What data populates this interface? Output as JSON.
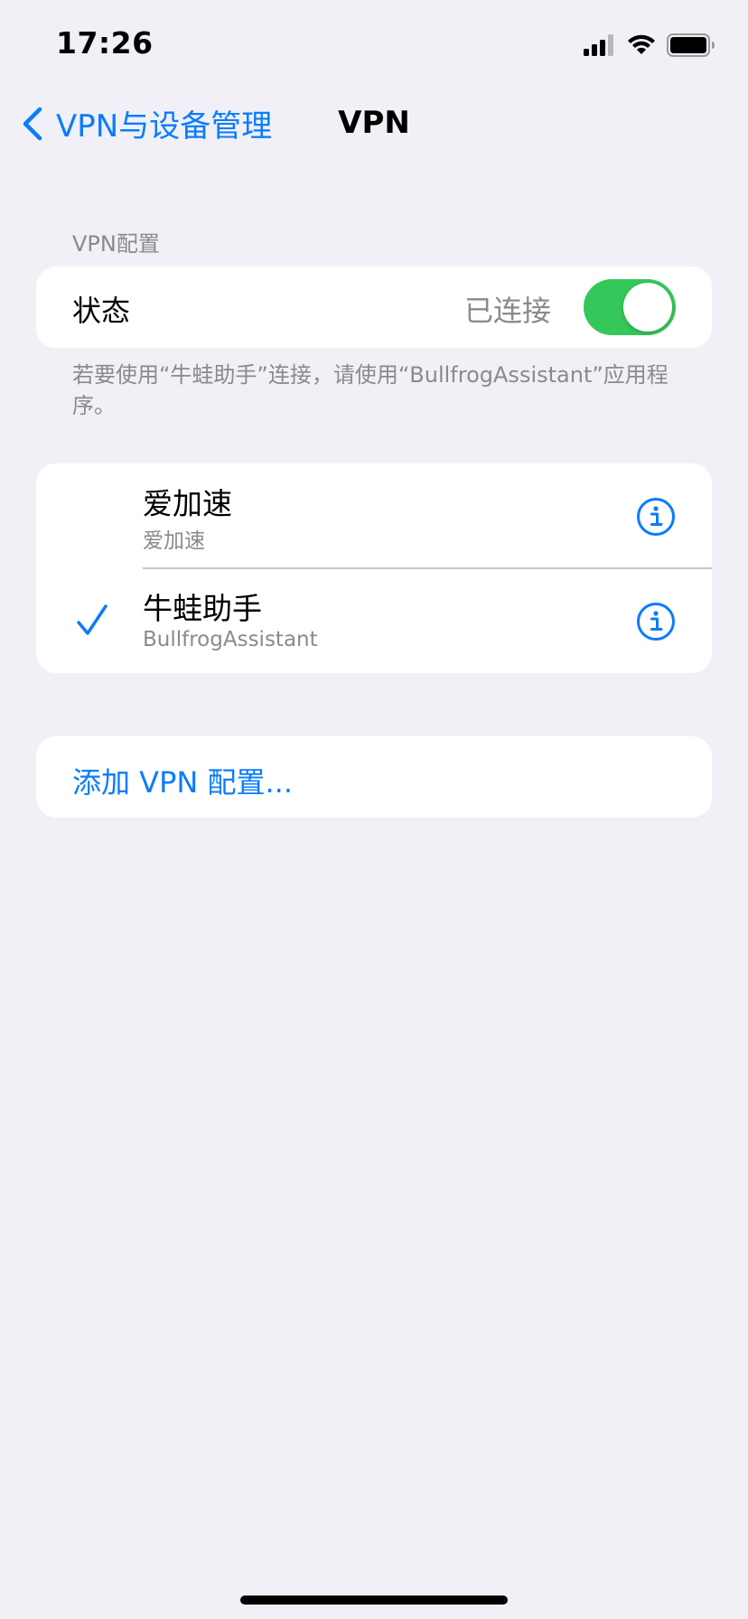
{
  "status_bar": {
    "time": "17:26"
  },
  "nav": {
    "back_label": "VPN与设备管理",
    "title": "VPN"
  },
  "section": {
    "header": "VPN配置",
    "status_label": "状态",
    "status_value": "已连接",
    "toggle_on": true,
    "footer_note": "若要使用“牛蛙助手”连接，请使用“BullfrogAssistant”应用程序。"
  },
  "vpn_list": [
    {
      "name": "爱加速",
      "subtitle": "爱加速",
      "selected": false
    },
    {
      "name": "牛蛙助手",
      "subtitle": "BullfrogAssistant",
      "selected": true
    }
  ],
  "add_config_label": "添加 VPN 配置...",
  "colors": {
    "accent": "#0a7cff",
    "toggle_on": "#34c759",
    "background": "#f0f0f6",
    "secondary_text": "#8a8a8e"
  },
  "icons": {
    "back": "chevron-left-icon",
    "signal": "cellular-signal-icon",
    "wifi": "wifi-icon",
    "battery": "battery-icon",
    "check": "checkmark-icon",
    "info": "info-circle-icon"
  }
}
